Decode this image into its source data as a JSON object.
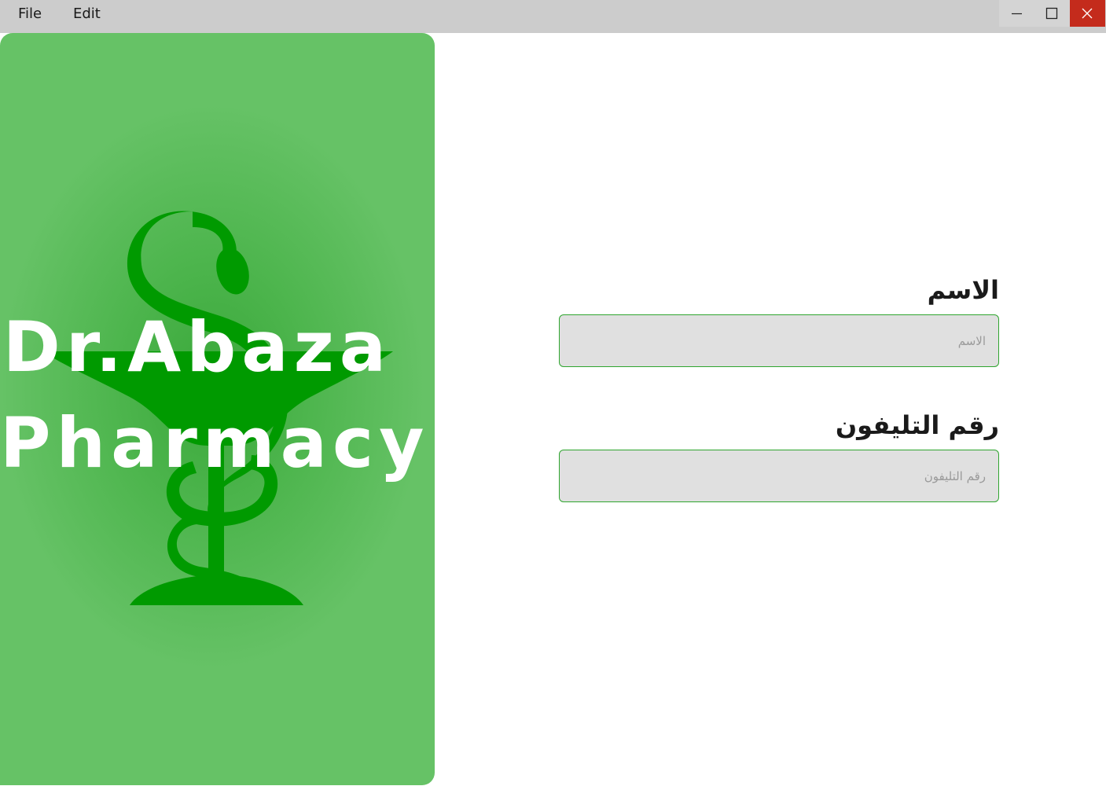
{
  "menu": {
    "file_label": "File",
    "edit_label": "Edit"
  },
  "window_controls": {
    "minimize_icon": "minimize-icon",
    "maximize_icon": "maximize-icon",
    "close_icon": "close-icon"
  },
  "brand": {
    "line1": "Dr.Abaza",
    "line2": "Pharmacy",
    "logo_icon": "bowl-of-hygieia-icon",
    "panel_color": "#66c266",
    "logo_color": "#009a00"
  },
  "form": {
    "name_label": "الاسم",
    "name_placeholder": "الاسم",
    "name_value": "",
    "phone_label": "رقم التليفون",
    "phone_placeholder": "رقم التليفون",
    "phone_value": "",
    "input_border_color": "#2fa52f",
    "input_background": "#e0e0e0"
  }
}
